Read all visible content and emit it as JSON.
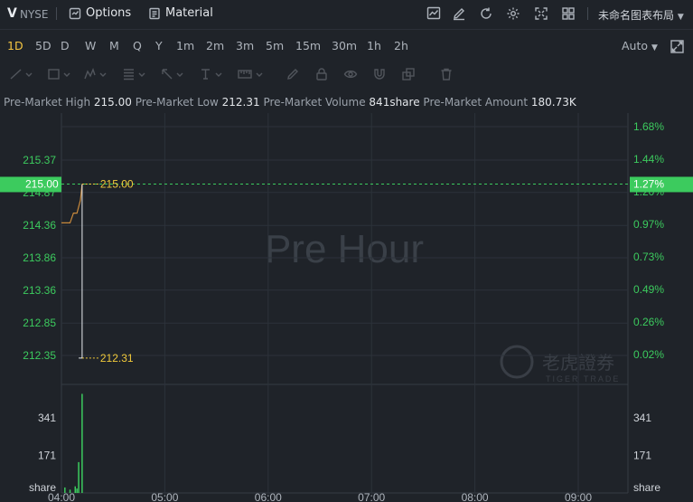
{
  "header": {
    "symbol": "V",
    "exchange": "NYSE",
    "options_label": "Options",
    "material_label": "Material",
    "layout_label": "未命名图表布局"
  },
  "periods": {
    "items": [
      "1D",
      "5D",
      "D",
      "W",
      "M",
      "Q",
      "Y",
      "1m",
      "2m",
      "3m",
      "5m",
      "15m",
      "30m",
      "1h",
      "2h"
    ],
    "active": "1D",
    "scale": "Auto"
  },
  "info": {
    "high_label": "Pre-Market High",
    "high_value": "215.00",
    "low_label": "Pre-Market Low",
    "low_value": "212.31",
    "volume_label": "Pre-Market Volume",
    "volume_value": "841share",
    "amount_label": "Pre-Market Amount",
    "amount_value": "180.73K"
  },
  "watermark": {
    "text": "Pre Hour",
    "brand_cn": "老虎證券",
    "brand_en": "TIGER TRADE"
  },
  "colors": {
    "up_green": "#3ccb5e",
    "price_line": "#c98a3c",
    "marker_yellow": "#f0c93a"
  },
  "chart_data": {
    "type": "line",
    "y_left_ticks": [
      "215.37",
      "214.87",
      "214.36",
      "213.86",
      "213.36",
      "212.85",
      "212.35"
    ],
    "y_right_ticks": [
      "1.68%",
      "1.44%",
      "1.20%",
      "0.97%",
      "0.73%",
      "0.49%",
      "0.26%",
      "0.02%"
    ],
    "current_price": "215.00",
    "current_pct": "1.27%",
    "high_marker": "215.00",
    "low_marker": "212.31",
    "x_ticks": [
      "04:00",
      "05:00",
      "06:00",
      "07:00",
      "08:00",
      "09:00"
    ],
    "price_series": [
      {
        "t": "04:00",
        "v": 214.4
      },
      {
        "t": "04:05",
        "v": 214.4
      },
      {
        "t": "04:07",
        "v": 214.55
      },
      {
        "t": "04:09",
        "v": 214.55
      },
      {
        "t": "04:11",
        "v": 214.75
      },
      {
        "t": "04:12",
        "v": 215.0
      },
      {
        "t": "04:12",
        "v": 212.31
      },
      {
        "t": "04:10",
        "v": 212.31
      }
    ],
    "volume_ticks": [
      "341",
      "171",
      "share"
    ],
    "volume_bars": [
      {
        "t": "04:02",
        "v": 25
      },
      {
        "t": "04:05",
        "v": 15
      },
      {
        "t": "04:08",
        "v": 30
      },
      {
        "t": "04:09",
        "v": 20
      },
      {
        "t": "04:10",
        "v": 140
      },
      {
        "t": "04:12",
        "v": 450
      }
    ]
  }
}
